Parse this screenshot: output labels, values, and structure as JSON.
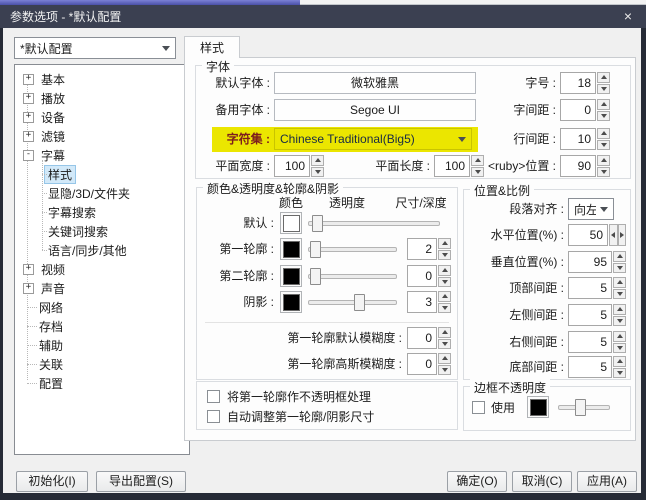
{
  "window": {
    "title": "参数选项 - *默认配置",
    "close_glyph": "×"
  },
  "preset": {
    "value": "*默认配置"
  },
  "tab": {
    "label": "样式"
  },
  "tree": {
    "items": [
      {
        "glyph": "+",
        "label": "基本"
      },
      {
        "glyph": "+",
        "label": "播放"
      },
      {
        "glyph": "+",
        "label": "设备"
      },
      {
        "glyph": "+",
        "label": "滤镜"
      },
      {
        "glyph": "-",
        "label": "字幕"
      },
      {
        "glyph": "",
        "label": "样式"
      },
      {
        "glyph": "",
        "label": "显隐/3D/文件夹"
      },
      {
        "glyph": "",
        "label": "字幕搜索"
      },
      {
        "glyph": "",
        "label": "关键词搜索"
      },
      {
        "glyph": "",
        "label": "语言/同步/其他"
      },
      {
        "glyph": "+",
        "label": "视频"
      },
      {
        "glyph": "+",
        "label": "声音"
      },
      {
        "glyph": "",
        "label": "网络"
      },
      {
        "glyph": "",
        "label": "存档"
      },
      {
        "glyph": "",
        "label": "辅助"
      },
      {
        "glyph": "",
        "label": "关联"
      },
      {
        "glyph": "",
        "label": "配置"
      }
    ]
  },
  "font_group": {
    "title": "字体",
    "default_font": {
      "label": "默认字体 :",
      "value": "微软雅黑"
    },
    "fallback_font": {
      "label": "备用字体 :",
      "value": "Segoe UI"
    },
    "charset": {
      "label": "字符集 :",
      "value": "Chinese Traditional(Big5)"
    },
    "plane_width": {
      "label": "平面宽度 :",
      "value": "100"
    },
    "plane_length": {
      "label": "平面长度 :",
      "value": "100"
    },
    "font_size": {
      "label": "字号 :",
      "value": "18"
    },
    "char_spacing": {
      "label": "字间距 :",
      "value": "0"
    },
    "line_spacing": {
      "label": "行间距 :",
      "value": "10"
    },
    "ruby_position": {
      "label": "<ruby>位置 :",
      "value": "90"
    }
  },
  "color_group": {
    "title": "颜色&透明度&轮廓&阴影",
    "col_color": "颜色",
    "col_opacity": "透明度",
    "col_size": "尺寸/深度",
    "rows": [
      {
        "label": "默认 :",
        "swatch": "#ffffff",
        "slider_pct": 3
      },
      {
        "label": "第一轮廓 :",
        "swatch": "#000000",
        "slider_pct": 3,
        "size": "2"
      },
      {
        "label": "第二轮廓 :",
        "swatch": "#000000",
        "slider_pct": 3,
        "size": "0"
      },
      {
        "label": "阴影 :",
        "swatch": "#000000",
        "slider_pct": 57,
        "size": "3"
      }
    ],
    "blur_default": {
      "label": "第一轮廓默认模糊度 :",
      "value": "0"
    },
    "blur_gauss": {
      "label": "第一轮廓高斯模糊度 :",
      "value": "0"
    }
  },
  "options": {
    "opaque_box": {
      "label": "将第一轮廓作不透明框处理",
      "checked": false
    },
    "auto_adjust": {
      "label": "自动调整第一轮廓/阴影尺寸",
      "checked": false
    }
  },
  "position_group": {
    "title": "位置&比例",
    "align": {
      "label": "段落对齐 :",
      "value": "向左"
    },
    "horizontal": {
      "label": "水平位置(%) :",
      "value": "50"
    },
    "vertical": {
      "label": "垂直位置(%) :",
      "value": "95"
    },
    "top_margin": {
      "label": "顶部间距 :",
      "value": "5"
    },
    "left_margin": {
      "label": "左侧间距 :",
      "value": "5"
    },
    "right_margin": {
      "label": "右侧间距 :",
      "value": "5"
    },
    "bottom_margin": {
      "label": "底部间距 :",
      "value": "5"
    }
  },
  "border_group": {
    "title": "边框不透明度",
    "use_label": "使用",
    "swatch": "#000000",
    "slider_pct": 40
  },
  "footer": {
    "init": "初始化(I)",
    "export": "导出配置(S)",
    "ok": "确定(O)",
    "cancel": "取消(C)",
    "apply": "应用(A)"
  },
  "colors": {
    "highlight_yellow": "#ebe600",
    "titlebar": "#3b4051"
  }
}
